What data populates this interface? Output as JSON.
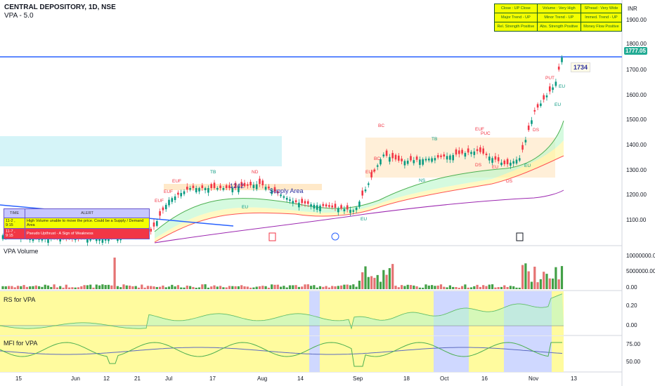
{
  "header": {
    "title": "CENTRAL DEPOSITORY, 1D, NSE",
    "indicator": "VPA - 5.0",
    "currency": "INR"
  },
  "status_table": {
    "rows": [
      [
        "Close : UP Close",
        "Volume : Very High",
        "SPread : Very Wide"
      ],
      [
        "Major Trend - UP",
        "Minor Trend - UP",
        "Immed. Trend - UP"
      ],
      [
        "Rel. Strength Positive",
        "Abs. Strength Positive",
        "Money Flow Positive"
      ]
    ]
  },
  "alerts": {
    "headers": [
      "TIME",
      "ALERT"
    ],
    "rows": [
      {
        "time": "11-2 , 9:15",
        "text": "High Volume unable to move the price. Could be a Supply / Demand Area"
      },
      {
        "time": "11-7 , 9:15",
        "text": "Pseudo Upthrust - A Sign of Weakness"
      }
    ]
  },
  "price_axis": {
    "ticks": [
      "1900.00",
      "1800.00",
      "1700.00",
      "1600.00",
      "1500.00",
      "1400.00",
      "1300.00",
      "1200.00",
      "1100.00"
    ],
    "last_price": "1777.05",
    "hline_label": "1734"
  },
  "panes": {
    "volume": {
      "label": "VPA Volume",
      "ticks": [
        "10000000.00",
        "5000000.00",
        "0.00"
      ]
    },
    "rs": {
      "label": "RS for VPA",
      "ticks": [
        "0.20",
        "0.00"
      ]
    },
    "mfi": {
      "label": "MFI for VPA",
      "ticks": [
        "75.00",
        "50.00"
      ]
    }
  },
  "time_axis": {
    "labels": [
      "15",
      "Jun",
      "12",
      "21",
      "Jul",
      "17",
      "Aug",
      "14",
      "Sep",
      "18",
      "Oct",
      "16",
      "Nov",
      "13"
    ]
  },
  "chart_labels": {
    "supply_area": "Supply Area",
    "level_1242": "1242",
    "signals": [
      "EUF",
      "EUF",
      "EUF",
      "TB",
      "ND",
      "EU",
      "BC",
      "BC",
      "EUF",
      "EU",
      "TB",
      "EUF",
      "PUC",
      "DS",
      "EU",
      "DS",
      "DS",
      "PUT",
      "EU",
      "EU",
      "NS",
      "EU"
    ],
    "events": [
      "E",
      "D",
      "E"
    ]
  },
  "colors": {
    "bull": "#089981",
    "bear": "#f23645",
    "blue_line": "#2962ff",
    "yellow_bg": "#fffb9e",
    "blue_bg": "#cfd8ff"
  }
}
